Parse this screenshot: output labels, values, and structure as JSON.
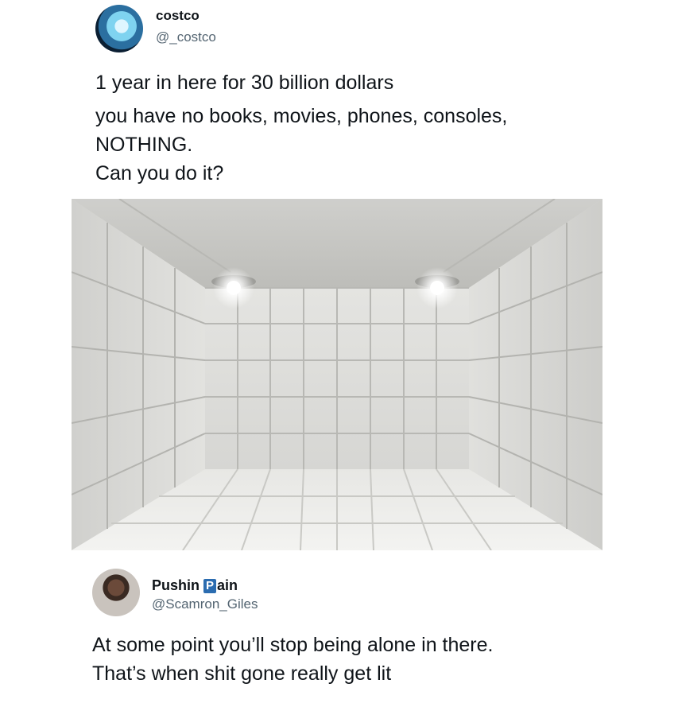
{
  "post": {
    "author_name": "costco",
    "author_handle": "@_costco",
    "lines": [
      "1 year in here for 30 billion dollars",
      "you have no books, movies, phones, consoles,",
      "NOTHING.",
      "Can you do it?"
    ]
  },
  "reply": {
    "author_name_prefix": "Pushin",
    "author_name_badge": "P",
    "author_name_suffix": "ain",
    "author_handle": "@Scamron_Giles",
    "lines": [
      "At some point you’ll stop being alone in there.",
      "That’s when shit gone really get lit"
    ]
  }
}
